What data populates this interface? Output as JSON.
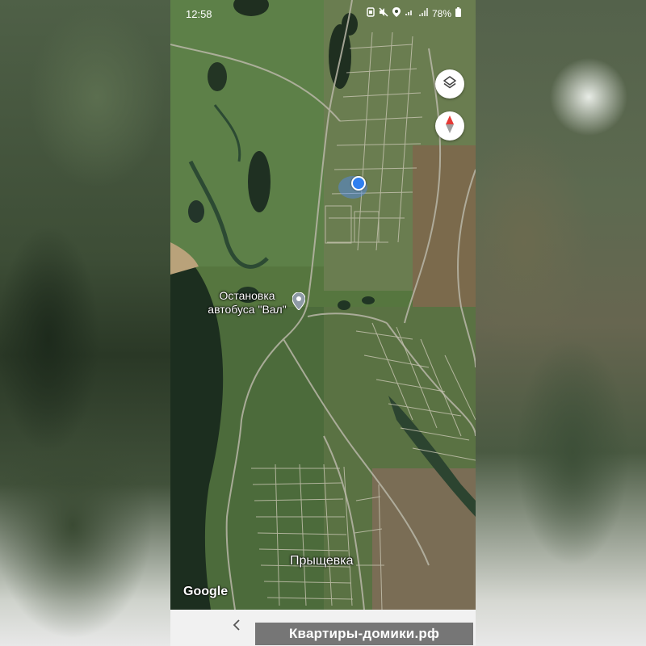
{
  "status_bar": {
    "time": "12:58",
    "battery": "78%",
    "icons": [
      "notification-icon",
      "mute-icon",
      "location-icon",
      "wifi-icon",
      "signal-icon",
      "battery-icon"
    ]
  },
  "map": {
    "provider_logo": "Google",
    "poi": {
      "label_line1": "Остановка",
      "label_line2": "автобуса \"Вал\"",
      "icon": "map-pin-icon"
    },
    "town_label": "Прыщевка",
    "controls": {
      "layers_icon": "layers-icon",
      "compass_icon": "compass-icon"
    },
    "colors": {
      "location_dot": "#2f7ff0",
      "compass_north": "#e53935"
    }
  },
  "nav_bar": {
    "back_icon": "back-chevron-icon"
  },
  "watermark": {
    "text": "Квартиры-домики.рф"
  }
}
